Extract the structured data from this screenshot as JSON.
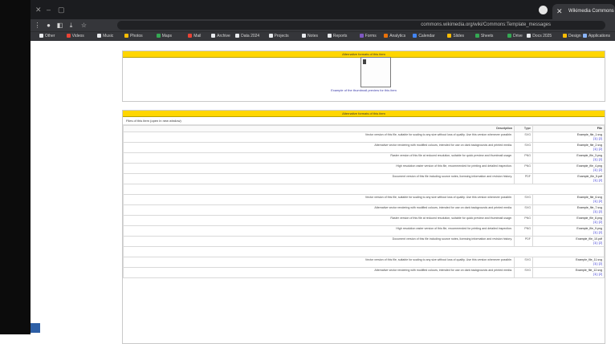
{
  "browser": {
    "tab_title": "Wikimedia Commons",
    "omnibox_text": "commons.wikimedia.org/wiki/Commons:Template_messages",
    "bookmarks": [
      {
        "label": "Applications",
        "color": "#8ab4f8"
      },
      {
        "label": "Design",
        "color": "#fbbc04"
      },
      {
        "label": "Docs 2025",
        "color": "#e8eaed"
      },
      {
        "label": "Drive",
        "color": "#34a853"
      },
      {
        "label": "Sheets",
        "color": "#34a853"
      },
      {
        "label": "Slides",
        "color": "#fbbc04"
      },
      {
        "label": "Calendar",
        "color": "#4285f4"
      },
      {
        "label": "Analytics",
        "color": "#e8710a"
      },
      {
        "label": "Forms",
        "color": "#7e57c2"
      },
      {
        "label": "Reports",
        "color": "#e8eaed"
      },
      {
        "label": "Notes",
        "color": "#e8eaed"
      },
      {
        "label": "Projects",
        "color": "#e8eaed"
      },
      {
        "label": "Data 2024",
        "color": "#e8eaed"
      },
      {
        "label": "Archive",
        "color": "#e8eaed"
      },
      {
        "label": "Mail",
        "color": "#ea4335"
      },
      {
        "label": "Maps",
        "color": "#34a853"
      },
      {
        "label": "Photos",
        "color": "#fbbc04"
      },
      {
        "label": "Music",
        "color": "#e8eaed"
      },
      {
        "label": "Videos",
        "color": "#ea4335"
      },
      {
        "label": "Other",
        "color": "#e8eaed"
      }
    ]
  },
  "page": {
    "top_pane_header": "Alternative formats of this item",
    "preview_caption": "Example of the thumbnail preview for this item",
    "table_pane_header": "Alternative formats of this item",
    "table_title": "Files of this item (open in new window)",
    "columns": {
      "file": "File",
      "type": "Type",
      "description": "Description"
    },
    "group1": [
      {
        "file": "Example_file_1.svg",
        "links": "[1] | [2]",
        "type": "SVG",
        "description": "Vector version of this file, suitable for scaling to any size without loss of quality. Use this version whenever possible."
      },
      {
        "file": "Example_file_2.svg",
        "links": "[1] | [2]",
        "type": "SVG",
        "description": "Alternative vector rendering with modified colours, intended for use on dark backgrounds and printed media."
      },
      {
        "file": "Example_file_3.png",
        "links": "[1] | [2]",
        "type": "PNG",
        "description": "Raster version of this file at reduced resolution, suitable for quick preview and thumbnail usage."
      },
      {
        "file": "Example_file_4.png",
        "links": "[1] | [2]",
        "type": "PNG",
        "description": "High resolution raster version of this file, recommended for printing and detailed inspection."
      },
      {
        "file": "Example_file_5.pdf",
        "links": "[1] | [2]",
        "type": "PDF",
        "description": "Document version of this file including source notes, licensing information and revision history."
      }
    ],
    "group2": [
      {
        "file": "Example_file_6.svg",
        "links": "[1] | [2]",
        "type": "SVG",
        "description": "Vector version of this file, suitable for scaling to any size without loss of quality. Use this version whenever possible."
      },
      {
        "file": "Example_file_7.svg",
        "links": "[1] | [2]",
        "type": "SVG",
        "description": "Alternative vector rendering with modified colours, intended for use on dark backgrounds and printed media."
      },
      {
        "file": "Example_file_8.png",
        "links": "[1] | [2]",
        "type": "PNG",
        "description": "Raster version of this file at reduced resolution, suitable for quick preview and thumbnail usage."
      },
      {
        "file": "Example_file_9.png",
        "links": "[1] | [2]",
        "type": "PNG",
        "description": "High resolution raster version of this file, recommended for printing and detailed inspection."
      },
      {
        "file": "Example_file_10.pdf",
        "links": "[1] | [2]",
        "type": "PDF",
        "description": "Document version of this file including source notes, licensing information and revision history."
      }
    ],
    "group3": [
      {
        "file": "Example_file_11.svg",
        "links": "[1] | [2]",
        "type": "SVG",
        "description": "Vector version of this file, suitable for scaling to any size without loss of quality. Use this version whenever possible."
      },
      {
        "file": "Example_file_12.svg",
        "links": "[1] | [2]",
        "type": "SVG",
        "description": "Alternative vector rendering with modified colours, intended for use on dark backgrounds and printed media."
      }
    ]
  }
}
